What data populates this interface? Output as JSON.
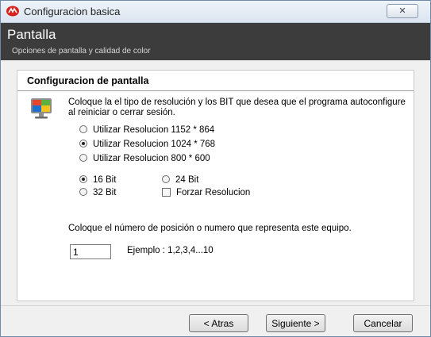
{
  "window": {
    "title": "Configuracion basica",
    "close_glyph": "✕",
    "app_icon": "app-logo-icon"
  },
  "banner": {
    "title": "Pantalla",
    "subtitle": "Opciones de pantalla y calidad de color",
    "background": "#3c3c3c"
  },
  "section": {
    "title": "Configuracion de pantalla",
    "description": "Coloque la el tipo de resolución y los BIT que desea que el programa autoconfigure al reiniciar o cerrar sesión.",
    "icon": "monitor-icon"
  },
  "resolution_options": [
    {
      "label": "Utilizar Resolucion 1152 * 864",
      "selected": false
    },
    {
      "label": "Utilizar Resolucion 1024 * 768",
      "selected": true
    },
    {
      "label": "Utilizar Resolucion 800 * 600",
      "selected": false
    }
  ],
  "bit_options": {
    "bit16": {
      "label": "16 Bit",
      "selected": true
    },
    "bit24": {
      "label": "24 Bit",
      "selected": false
    },
    "bit32": {
      "label": "32 Bit",
      "selected": false
    }
  },
  "force_resolution": {
    "label": "Forzar Resolucion",
    "checked": false
  },
  "position": {
    "label": "Coloque el número de posición o numero que representa este equipo.",
    "value": "1",
    "example": "Ejemplo : 1,2,3,4...10"
  },
  "buttons": {
    "back": "< Atras",
    "next": "Siguiente >",
    "cancel": "Cancelar"
  }
}
